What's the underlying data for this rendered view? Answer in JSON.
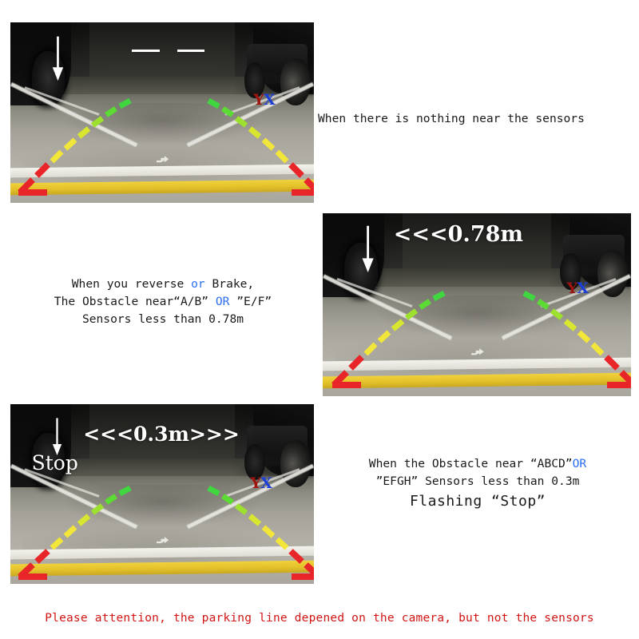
{
  "document": {
    "title": "Reversing camera parking sensor distance guide"
  },
  "panels": [
    {
      "id": "panel-no-obstacle",
      "photo_label": "reversing-camera-view-clear",
      "overlay": {
        "arrow": "down-arrow-icon",
        "dashes": [
          "—",
          "—"
        ],
        "distance_text": "",
        "stop_text": ""
      },
      "logo": {
        "first": "Y",
        "second": "X"
      },
      "caption_lines": [
        [
          {
            "text": "When there is nothing near the sensors",
            "color": "black"
          }
        ]
      ]
    },
    {
      "id": "panel-078m",
      "photo_label": "reversing-camera-view-078m",
      "overlay": {
        "arrow": "down-arrow-icon",
        "dashes": [],
        "distance_text": "<<<0.78m",
        "stop_text": ""
      },
      "logo": {
        "first": "Y",
        "second": "X"
      },
      "caption_lines": [
        [
          {
            "text": "When you reverse ",
            "color": "black"
          },
          {
            "text": "or",
            "color": "blue"
          },
          {
            "text": " Brake,",
            "color": "black"
          }
        ],
        [
          {
            "text": "The Obstacle near“A/B” ",
            "color": "black"
          },
          {
            "text": "OR",
            "color": "blue"
          },
          {
            "text": " ”E/F”",
            "color": "black"
          }
        ],
        [
          {
            "text": "Sensors less than 0.78m",
            "color": "black"
          }
        ]
      ]
    },
    {
      "id": "panel-03m",
      "photo_label": "reversing-camera-view-03m",
      "overlay": {
        "arrow": "down-arrow-icon",
        "dashes": [],
        "distance_text": "<<<0.3m>>>",
        "stop_text": "Stop"
      },
      "logo": {
        "first": "Y",
        "second": "X"
      },
      "caption_lines": [
        [
          {
            "text": "When the Obstacle near “ABCD”",
            "color": "black"
          },
          {
            "text": "OR",
            "color": "blue"
          }
        ],
        [
          {
            "text": "”EFGH” Sensors less than 0.3m",
            "color": "black"
          }
        ],
        [
          {
            "text": "Flashing “Stop”",
            "color": "black"
          }
        ]
      ]
    }
  ],
  "captions": {
    "panel1_line1": "When there is nothing near the sensors",
    "panel2_line1_a": "When you reverse ",
    "panel2_line1_b": "or",
    "panel2_line1_c": " Brake,",
    "panel2_line2_a": "The Obstacle near“A/B” ",
    "panel2_line2_b": "OR",
    "panel2_line2_c": " ”E/F”",
    "panel2_line3": "Sensors less than 0.78m",
    "panel3_line1_a": "When the Obstacle near “ABCD”",
    "panel3_line1_b": "OR",
    "panel3_line2": "”EFGH” Sensors less than 0.3m",
    "panel3_line3": "Flashing “Stop”"
  },
  "overlays": {
    "distance_078": "<<<0.78m",
    "distance_03": "<<<0.3m>>>",
    "stop": "Stop",
    "dash1": "—",
    "dash2": "—"
  },
  "logo": {
    "y": "Y",
    "x": "X",
    "y_color": "#a0140f",
    "x_color": "#1e3fd6"
  },
  "warning": {
    "text": "Please attention, the parking line depened on the camera, but not the sensors",
    "color": "#d21414"
  },
  "guideline_colors": {
    "near": "#e8262a",
    "mid": "#f2e63a",
    "far": "#3fd63f"
  },
  "accent_colors": {
    "blue_text": "#2b6ff0",
    "black_text": "#1a1a1a",
    "white_overlay": "#ffffff"
  }
}
